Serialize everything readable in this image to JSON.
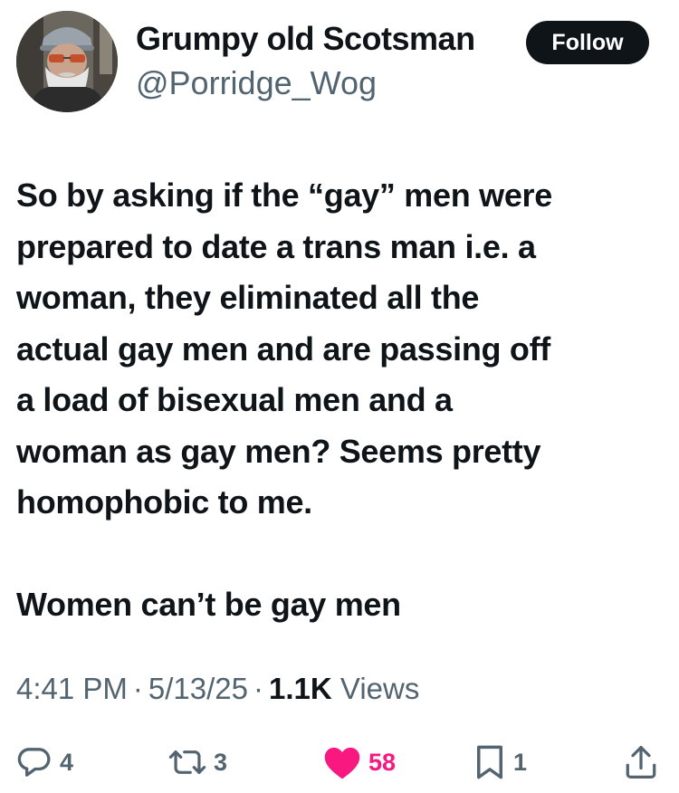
{
  "author": {
    "display_name": "Grumpy old Scotsman",
    "handle": "@Porridge_Wog",
    "follow_label": "Follow"
  },
  "tweet": {
    "lines": [
      "So by asking if the “gay” men were",
      "prepared to date a trans man i.e. a",
      "woman, they eliminated all the",
      "actual gay men and are passing off",
      "a load of bisexual men and a",
      "woman as gay men? Seems pretty",
      "homophobic to me."
    ],
    "closing_line": "Women can’t be gay men"
  },
  "meta": {
    "time": "4:41 PM",
    "separator": "·",
    "date": "5/13/25",
    "views_count": "1.1K",
    "views_label": "Views"
  },
  "actions": {
    "replies": "4",
    "reposts": "3",
    "likes": "58",
    "bookmarks": "1"
  },
  "colors": {
    "text": "#0f1419",
    "secondary": "#536471",
    "like": "#f91880",
    "follow_bg": "#0f1419"
  },
  "icons": [
    "reply-icon",
    "repost-icon",
    "heart-icon",
    "bookmark-icon",
    "share-icon"
  ]
}
